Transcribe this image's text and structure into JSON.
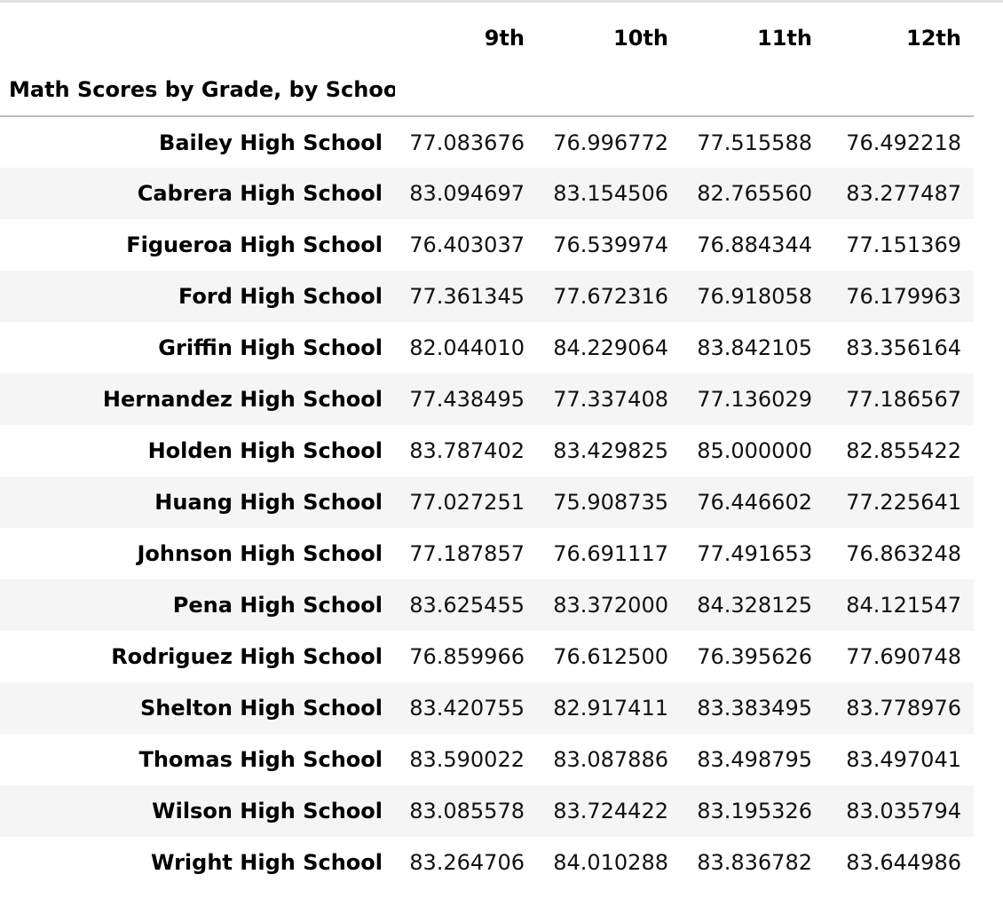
{
  "table": {
    "index_name": "Math Scores by Grade, by School",
    "columns": [
      "9th",
      "10th",
      "11th",
      "12th"
    ],
    "rows": [
      {
        "school": "Bailey High School",
        "values": [
          "77.083676",
          "76.996772",
          "77.515588",
          "76.492218"
        ]
      },
      {
        "school": "Cabrera High School",
        "values": [
          "83.094697",
          "83.154506",
          "82.765560",
          "83.277487"
        ]
      },
      {
        "school": "Figueroa High School",
        "values": [
          "76.403037",
          "76.539974",
          "76.884344",
          "77.151369"
        ]
      },
      {
        "school": "Ford High School",
        "values": [
          "77.361345",
          "77.672316",
          "76.918058",
          "76.179963"
        ]
      },
      {
        "school": "Griffin High School",
        "values": [
          "82.044010",
          "84.229064",
          "83.842105",
          "83.356164"
        ]
      },
      {
        "school": "Hernandez High School",
        "values": [
          "77.438495",
          "77.337408",
          "77.136029",
          "77.186567"
        ]
      },
      {
        "school": "Holden High School",
        "values": [
          "83.787402",
          "83.429825",
          "85.000000",
          "82.855422"
        ]
      },
      {
        "school": "Huang High School",
        "values": [
          "77.027251",
          "75.908735",
          "76.446602",
          "77.225641"
        ]
      },
      {
        "school": "Johnson High School",
        "values": [
          "77.187857",
          "76.691117",
          "77.491653",
          "76.863248"
        ]
      },
      {
        "school": "Pena High School",
        "values": [
          "83.625455",
          "83.372000",
          "84.328125",
          "84.121547"
        ]
      },
      {
        "school": "Rodriguez High School",
        "values": [
          "76.859966",
          "76.612500",
          "76.395626",
          "77.690748"
        ]
      },
      {
        "school": "Shelton High School",
        "values": [
          "83.420755",
          "82.917411",
          "83.383495",
          "83.778976"
        ]
      },
      {
        "school": "Thomas High School",
        "values": [
          "83.590022",
          "83.087886",
          "83.498795",
          "83.497041"
        ]
      },
      {
        "school": "Wilson High School",
        "values": [
          "83.085578",
          "83.724422",
          "83.195326",
          "83.035794"
        ]
      },
      {
        "school": "Wright High School",
        "values": [
          "83.264706",
          "84.010288",
          "83.836782",
          "83.644986"
        ]
      }
    ]
  },
  "colors": {
    "stripe": "#f5f5f5",
    "header_rule": "#bdbdbd",
    "top_rule": "#e3e3e3"
  }
}
